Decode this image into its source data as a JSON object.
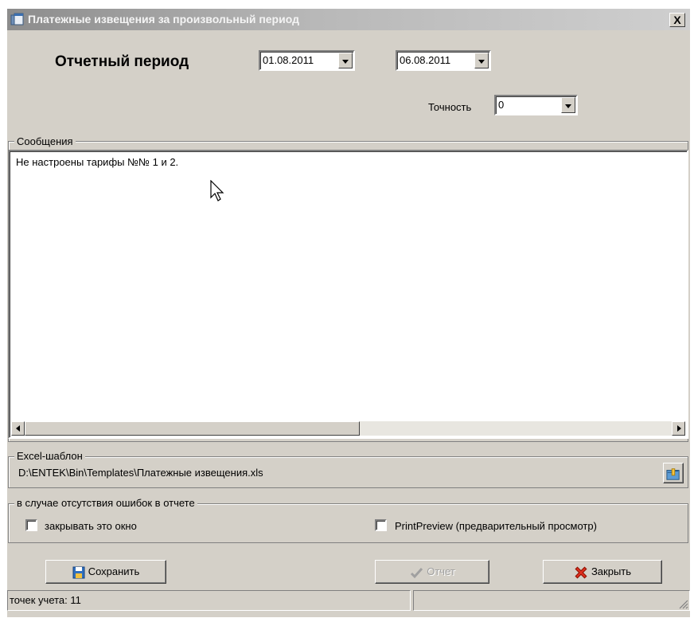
{
  "window": {
    "title": "Платежные извещения за произвольный период",
    "close_label": "X"
  },
  "period": {
    "label": "Отчетный период",
    "date_from": "01.08.2011",
    "date_to": "06.08.2011"
  },
  "precision": {
    "label": "Точность",
    "value": "0"
  },
  "messages": {
    "group_title": "Сообщения",
    "lines": [
      "Не настроены тарифы №№ 1 и 2."
    ]
  },
  "template": {
    "group_title": "Excel-шаблон",
    "path": "D:\\ENTEK\\Bin\\Templates\\Платежные извещения.xls"
  },
  "options": {
    "group_title": "в случае отсутствия ошибок в отчете",
    "close_window_label": "закрывать это окно",
    "close_window_checked": false,
    "print_preview_label": "PrintPreview (предварительный просмотр)",
    "print_preview_checked": false
  },
  "buttons": {
    "save": "Сохранить",
    "report": "Отчет",
    "close": "Закрыть"
  },
  "status": {
    "points": "точек учета: 11"
  },
  "colors": {
    "window_bg": "#d4d0c8",
    "title_gradient": "#8c8c8c"
  }
}
